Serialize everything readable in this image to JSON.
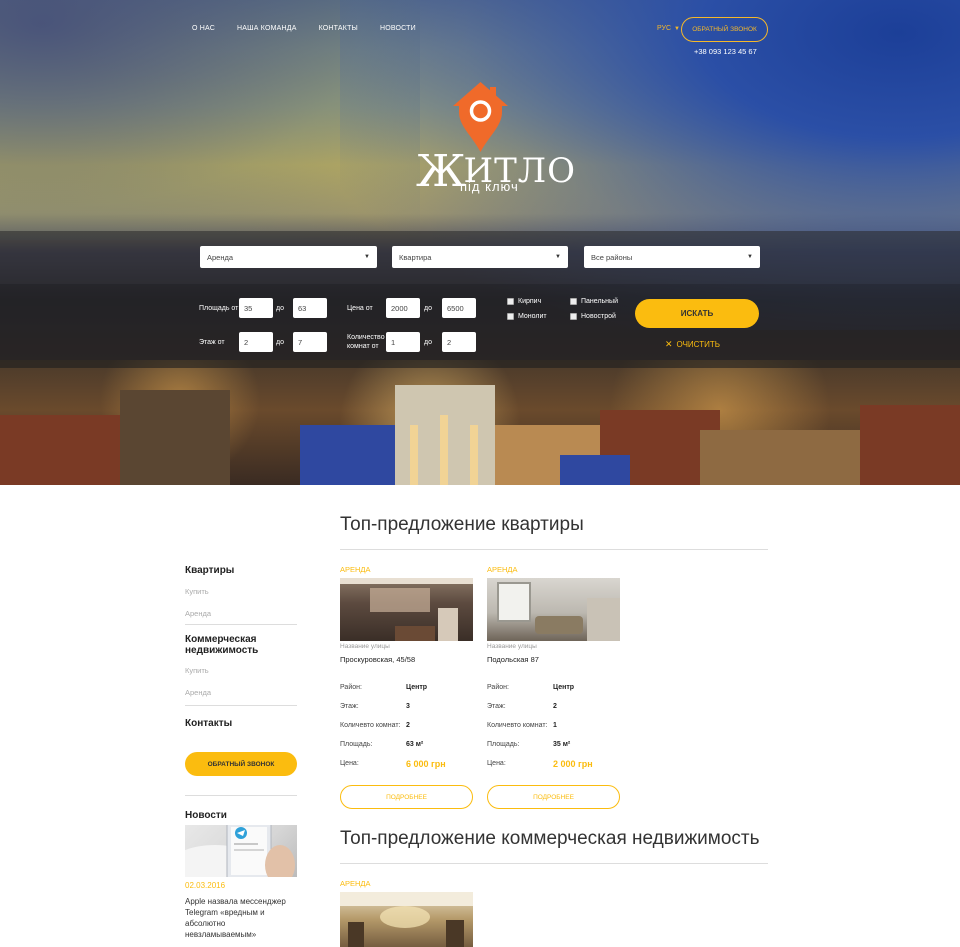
{
  "colors": {
    "accent": "#fbbc0f",
    "text": "#333333"
  },
  "nav": {
    "items": [
      "О НАС",
      "НАША КОМАНДА",
      "КОНТАКТЫ",
      "НОВОСТИ"
    ],
    "lang": "РУС",
    "callback": "ОБРАТНЫЙ ЗВОНОК",
    "phone": "+38 093 123 45 67"
  },
  "logo": {
    "title_big": "Ж",
    "title_rest": "ИТЛО",
    "subtitle": "під ключ"
  },
  "search": {
    "deal_type": "Аренда",
    "property_type": "Квартира",
    "district": "Все районы",
    "area_label": "Площадь от",
    "area_from": "35",
    "area_to": "63",
    "to_label": "до",
    "price_label": "Цена от",
    "price_from": "2000",
    "price_to": "6500",
    "floor_label": "Этаж от",
    "floor_from": "2",
    "floor_to": "7",
    "rooms_label_1": "Количество",
    "rooms_label_2": "комнат от",
    "rooms_from": "1",
    "rooms_to": "2",
    "checks": [
      "Кирпич",
      "Панельный",
      "Монолит",
      "Новострой"
    ],
    "search_button": "ИСКАТЬ",
    "clear_button": "ОЧИСТИТЬ"
  },
  "sidebar": {
    "apartments": "Квартиры",
    "buy": "Купить",
    "rent": "Аренда",
    "commercial": "Коммерческая недвижимость",
    "buy2": "Купить",
    "rent2": "Аренда",
    "contacts": "Контакты",
    "callback": "ОБРАТНЫЙ ЗВОНОК",
    "news": "Новости",
    "news_date": "02.03.2016",
    "news_text": "Apple назвала мессенджер Telegram «вредным и абсолютно невзламываемым»"
  },
  "section1": {
    "title": "Топ-предложение квартиры",
    "cards": [
      {
        "tag": "АРЕНДА",
        "caption": "Название улицы",
        "address": "Проскуровская, 45/58",
        "district_label": "Район:",
        "district": "Центр",
        "floor_label": "Этаж:",
        "floor": "3",
        "rooms_label": "Количевто комнат:",
        "rooms": "2",
        "area_label": "Площадь:",
        "area": "63 м²",
        "price_label": "Цена:",
        "price": "6 000 грн",
        "more": "ПОДРОБНЕЕ"
      },
      {
        "tag": "АРЕНДА",
        "caption": "Название улицы",
        "address": "Подольская 87",
        "district_label": "Район:",
        "district": "Центр",
        "floor_label": "Этаж:",
        "floor": "2",
        "rooms_label": "Количевто комнат:",
        "rooms": "1",
        "area_label": "Площадь:",
        "area": "35 м²",
        "price_label": "Цена:",
        "price": "2 000 грн",
        "more": "ПОДРОБНЕЕ"
      }
    ]
  },
  "section2": {
    "title": "Топ-предложение коммерческая недвижимость",
    "tag": "АРЕНДА"
  }
}
